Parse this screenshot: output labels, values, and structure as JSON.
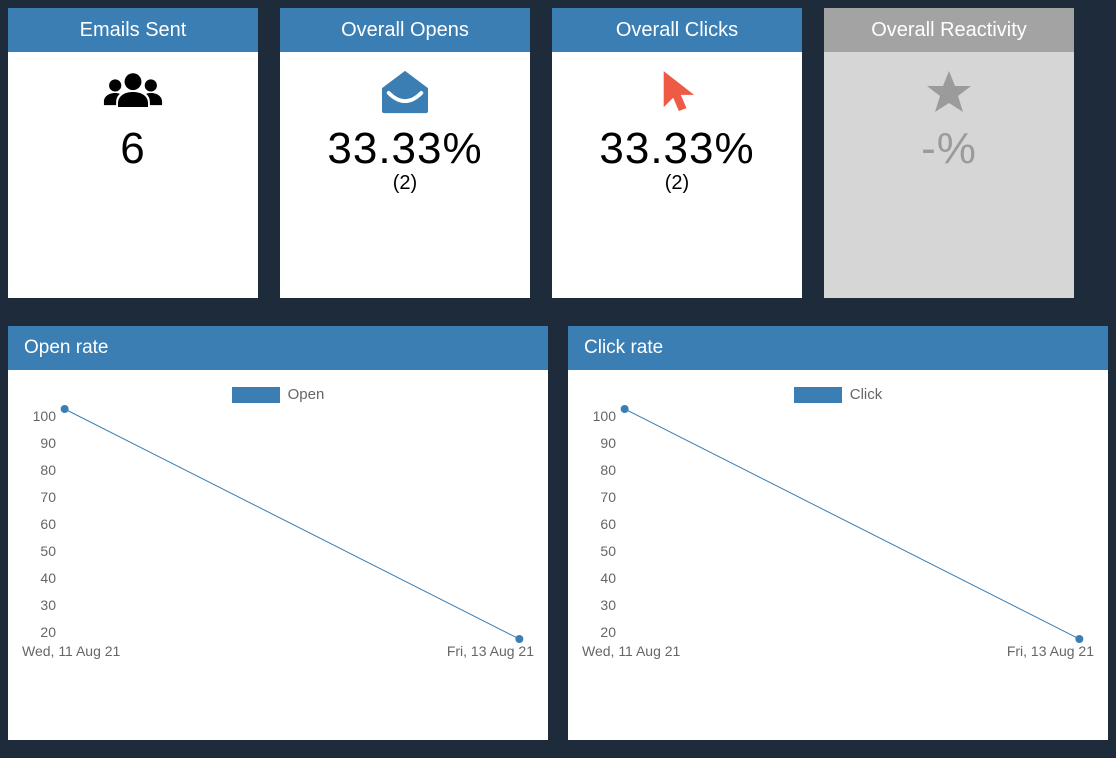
{
  "cards": {
    "emails_sent": {
      "title": "Emails Sent",
      "value": "6",
      "icon": "users-icon"
    },
    "overall_opens": {
      "title": "Overall Opens",
      "value": "33.33%",
      "subvalue": "(2)",
      "icon": "envelope-open-icon"
    },
    "overall_clicks": {
      "title": "Overall Clicks",
      "value": "33.33%",
      "subvalue": "(2)",
      "icon": "cursor-click-icon"
    },
    "overall_reactivity": {
      "title": "Overall Reactivity",
      "value": "-%",
      "icon": "star-icon",
      "disabled": true
    }
  },
  "charts": {
    "open_rate": {
      "title": "Open rate",
      "legend_label": "Open"
    },
    "click_rate": {
      "title": "Click rate",
      "legend_label": "Click"
    },
    "y_ticks": [
      "100",
      "90",
      "80",
      "70",
      "60",
      "50",
      "40",
      "30",
      "20"
    ],
    "x_start": "Wed, 11 Aug 21",
    "x_end": "Fri, 13 Aug 21"
  },
  "colors": {
    "accent": "#3a7eb3",
    "bg": "#1e2b3a",
    "cursor": "#ef5a46",
    "disabled": "#9b9b9b"
  },
  "chart_data": [
    {
      "type": "line",
      "title": "Open rate",
      "xlabel": "",
      "ylabel": "",
      "ylim": [
        20,
        100
      ],
      "series": [
        {
          "name": "Open",
          "x": [
            "Wed, 11 Aug 21",
            "Fri, 13 Aug 21"
          ],
          "values": [
            100,
            20
          ]
        }
      ],
      "legend_position": "top"
    },
    {
      "type": "line",
      "title": "Click rate",
      "xlabel": "",
      "ylabel": "",
      "ylim": [
        20,
        100
      ],
      "series": [
        {
          "name": "Click",
          "x": [
            "Wed, 11 Aug 21",
            "Fri, 13 Aug 21"
          ],
          "values": [
            100,
            20
          ]
        }
      ],
      "legend_position": "top"
    }
  ]
}
